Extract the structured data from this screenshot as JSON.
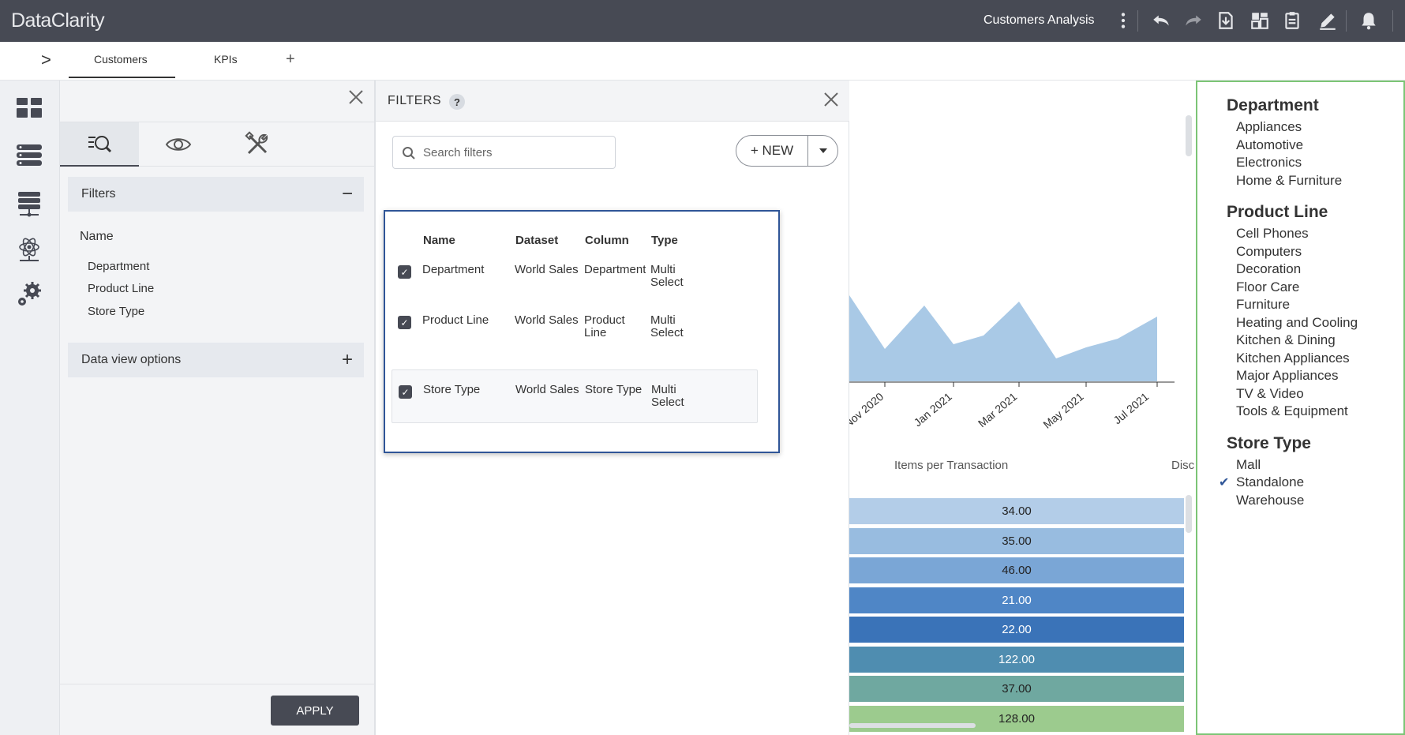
{
  "app": {
    "logo": "DataClarity",
    "doc_title": "Customers Analysis"
  },
  "tabs": [
    {
      "label": "Customers",
      "active": true
    },
    {
      "label": "KPIs",
      "active": false
    }
  ],
  "tabs_add": "+",
  "expand_glyph": ">",
  "left_panel": {
    "filters_label": "Filters",
    "filters_toggle": "−",
    "name_label": "Name",
    "items": [
      "Department",
      "Product Line",
      "Store Type"
    ],
    "data_view_label": "Data view options",
    "data_view_toggle": "+",
    "apply_label": "APPLY"
  },
  "filters_dialog": {
    "title": "FILTERS",
    "help": "?",
    "search_placeholder": "Search filters",
    "new_label": "+ NEW",
    "columns": [
      "Name",
      "Dataset",
      "Column",
      "Type"
    ],
    "rows": [
      {
        "name": "Department",
        "dataset": "World Sales",
        "column": "Department",
        "type": "Multi Select",
        "checked": true
      },
      {
        "name": "Product Line",
        "dataset": "World Sales",
        "column": "Product Line",
        "type": "Multi Select",
        "checked": true
      },
      {
        "name": "Store Type",
        "dataset": "World Sales",
        "column": "Store Type",
        "type": "Multi Select",
        "checked": true
      }
    ]
  },
  "background_chart": {
    "x_ticks": [
      "Nov 2020",
      "Jan 2021",
      "Mar 2021",
      "May 2021",
      "Jul 2021"
    ],
    "table_header": "Items per Transaction",
    "table_header_2": "Disc",
    "rows": [
      {
        "value": "34.00",
        "color": "#b3cde8"
      },
      {
        "value": "35.00",
        "color": "#98bce0"
      },
      {
        "value": "46.00",
        "color": "#7aa6d6"
      },
      {
        "value": "21.00",
        "color": "#4f86c6"
      },
      {
        "value": "22.00",
        "color": "#3a73b8"
      },
      {
        "value": "122.00",
        "color": "#4f8db0"
      },
      {
        "value": "37.00",
        "color": "#6fa8a0"
      },
      {
        "value": "128.00",
        "color": "#9ccb8e"
      }
    ]
  },
  "right_panel": {
    "sections": [
      {
        "title": "Department",
        "items": [
          "Appliances",
          "Automotive",
          "Electronics",
          "Home & Furniture"
        ]
      },
      {
        "title": "Product Line",
        "items": [
          "Cell Phones",
          "Computers",
          "Decoration",
          "Floor Care",
          "Furniture",
          "Heating and Cooling",
          "Kitchen & Dining",
          "Kitchen Appliances",
          "Major Appliances",
          "TV & Video",
          "Tools & Equipment"
        ]
      },
      {
        "title": "Store Type",
        "items": [
          "Mall",
          "Standalone",
          "Warehouse"
        ]
      }
    ],
    "checked_item": "Standalone"
  },
  "colors": {
    "topbar": "#474a54",
    "dialog_border": "#2f5597",
    "right_panel_border": "#7cc576",
    "area_fill": "#a9c9e6"
  }
}
